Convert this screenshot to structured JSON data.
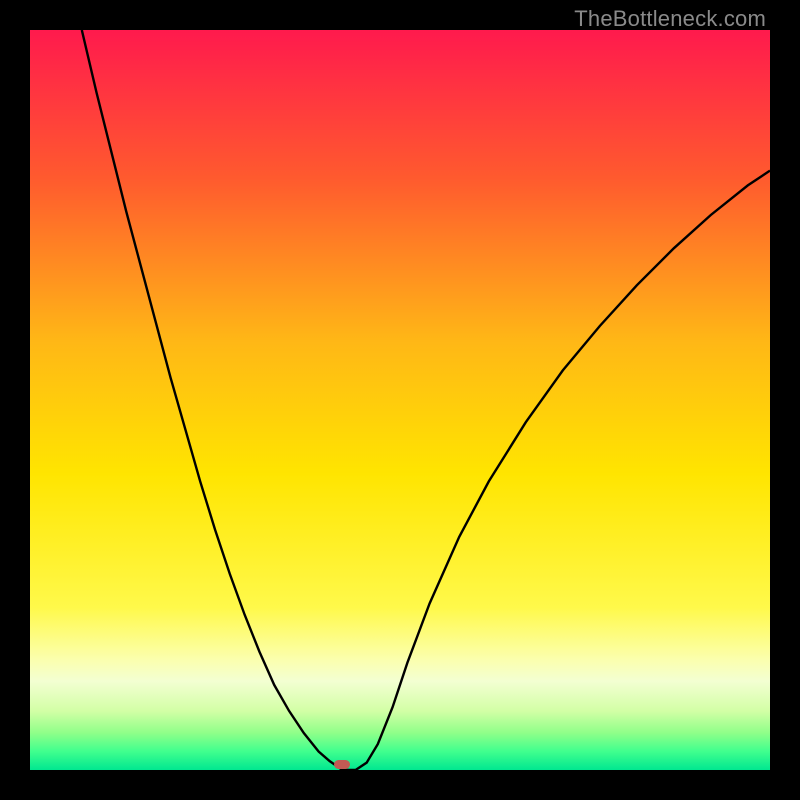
{
  "watermark": "TheBottleneck.com",
  "marker": {
    "x_fraction": 0.422,
    "y_fraction": 0.993,
    "color": "#c15a54"
  },
  "chart_data": {
    "type": "line",
    "title": "",
    "xlabel": "",
    "ylabel": "",
    "xlim": [
      0,
      1
    ],
    "ylim": [
      0,
      1
    ],
    "gradient_stops": [
      {
        "offset": 0.0,
        "color": "#ff1a4d"
      },
      {
        "offset": 0.2,
        "color": "#ff5a2e"
      },
      {
        "offset": 0.42,
        "color": "#ffb716"
      },
      {
        "offset": 0.6,
        "color": "#ffe500"
      },
      {
        "offset": 0.78,
        "color": "#fff94a"
      },
      {
        "offset": 0.85,
        "color": "#fbffad"
      },
      {
        "offset": 0.88,
        "color": "#f3ffd2"
      },
      {
        "offset": 0.92,
        "color": "#d3ffa6"
      },
      {
        "offset": 0.95,
        "color": "#8fff89"
      },
      {
        "offset": 0.975,
        "color": "#40ff8e"
      },
      {
        "offset": 1.0,
        "color": "#00e790"
      }
    ],
    "series": [
      {
        "name": "bottleneck-curve",
        "color": "#000000",
        "stroke_width": 2.4,
        "x": [
          0.07,
          0.09,
          0.11,
          0.13,
          0.15,
          0.17,
          0.19,
          0.21,
          0.23,
          0.25,
          0.27,
          0.29,
          0.31,
          0.33,
          0.35,
          0.37,
          0.39,
          0.405,
          0.415,
          0.422,
          0.44,
          0.455,
          0.47,
          0.49,
          0.51,
          0.54,
          0.58,
          0.62,
          0.67,
          0.72,
          0.77,
          0.82,
          0.87,
          0.92,
          0.97,
          1.0
        ],
        "y": [
          0.0,
          0.085,
          0.165,
          0.245,
          0.32,
          0.395,
          0.47,
          0.54,
          0.61,
          0.675,
          0.735,
          0.79,
          0.84,
          0.885,
          0.92,
          0.95,
          0.975,
          0.988,
          0.995,
          1.0,
          1.0,
          0.99,
          0.965,
          0.915,
          0.855,
          0.775,
          0.685,
          0.61,
          0.53,
          0.46,
          0.4,
          0.345,
          0.295,
          0.25,
          0.21,
          0.19
        ]
      }
    ],
    "marker_points": [
      {
        "x": 0.422,
        "y": 1.0,
        "color": "#c15a54"
      }
    ],
    "annotations": []
  }
}
